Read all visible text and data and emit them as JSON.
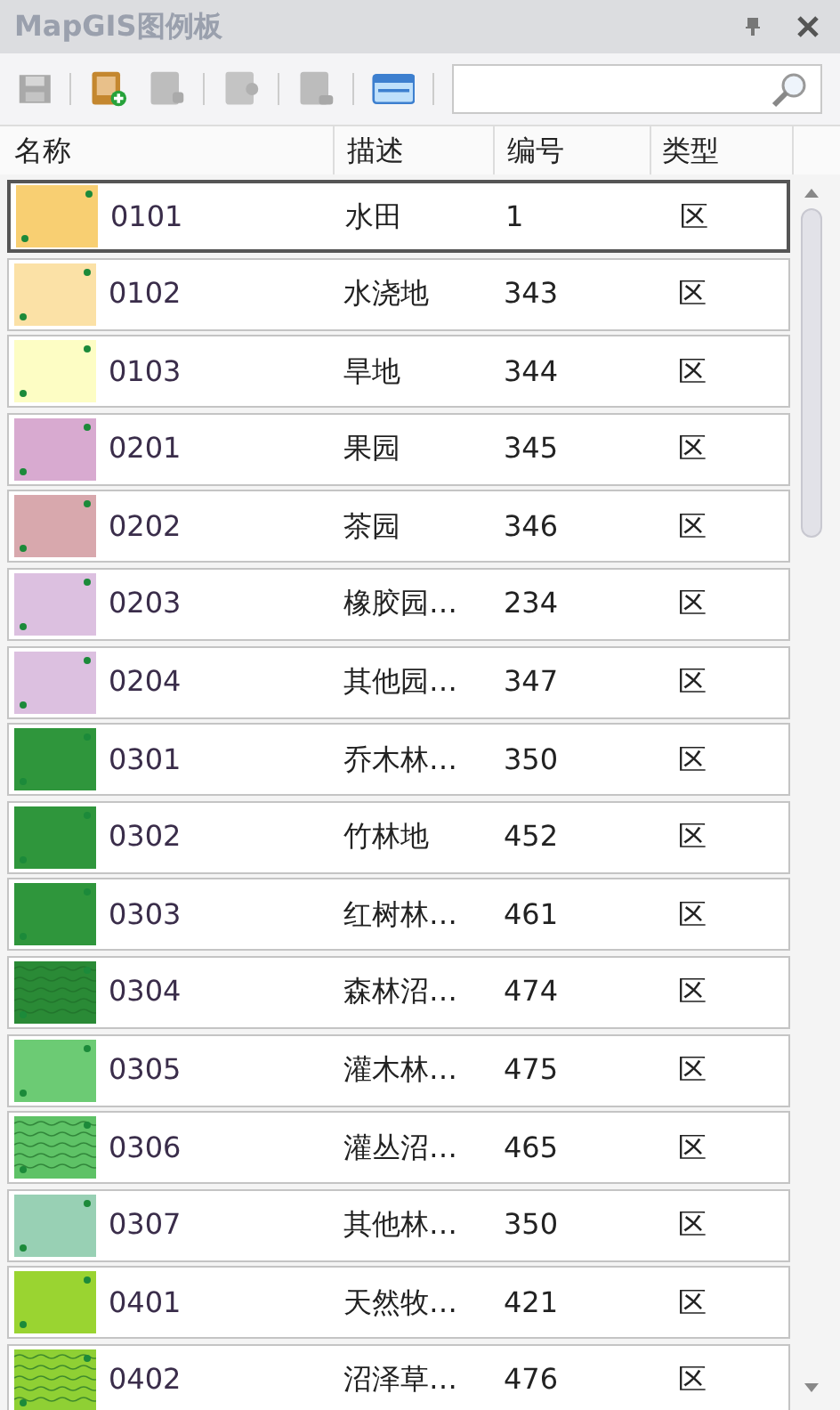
{
  "panel": {
    "title": "MapGIS图例板"
  },
  "table": {
    "columns": [
      "名称",
      "描述",
      "编号",
      "类型"
    ],
    "rows": [
      {
        "name": "0101",
        "description": "水田",
        "number": "1",
        "type": "区",
        "color": "#f8cf72",
        "textured": false,
        "selected": true
      },
      {
        "name": "0102",
        "description": "水浇地",
        "number": "343",
        "type": "区",
        "color": "#fbe1a6",
        "textured": false,
        "selected": false
      },
      {
        "name": "0103",
        "description": "旱地",
        "number": "344",
        "type": "区",
        "color": "#fdfdc4",
        "textured": false,
        "selected": false
      },
      {
        "name": "0201",
        "description": "果园",
        "number": "345",
        "type": "区",
        "color": "#d8aad0",
        "textured": false,
        "selected": false
      },
      {
        "name": "0202",
        "description": "茶园",
        "number": "346",
        "type": "区",
        "color": "#d8a8ad",
        "textured": false,
        "selected": false
      },
      {
        "name": "0203",
        "description": "橡胶园…",
        "number": "234",
        "type": "区",
        "color": "#dcc0e0",
        "textured": false,
        "selected": false
      },
      {
        "name": "0204",
        "description": "其他园…",
        "number": "347",
        "type": "区",
        "color": "#dcc0e0",
        "textured": false,
        "selected": false
      },
      {
        "name": "0301",
        "description": "乔木林…",
        "number": "350",
        "type": "区",
        "color": "#2f963c",
        "textured": false,
        "selected": false
      },
      {
        "name": "0302",
        "description": "竹林地",
        "number": "452",
        "type": "区",
        "color": "#2f963c",
        "textured": false,
        "selected": false
      },
      {
        "name": "0303",
        "description": "红树林…",
        "number": "461",
        "type": "区",
        "color": "#2f963c",
        "textured": false,
        "selected": false
      },
      {
        "name": "0304",
        "description": "森林沼…",
        "number": "474",
        "type": "区",
        "color": "#2a8a36",
        "textured": true,
        "selected": false
      },
      {
        "name": "0305",
        "description": "灌木林…",
        "number": "475",
        "type": "区",
        "color": "#6ccb74",
        "textured": false,
        "selected": false
      },
      {
        "name": "0306",
        "description": "灌丛沼…",
        "number": "465",
        "type": "区",
        "color": "#5ec266",
        "textured": true,
        "selected": false
      },
      {
        "name": "0307",
        "description": "其他林…",
        "number": "350",
        "type": "区",
        "color": "#98d0b4",
        "textured": false,
        "selected": false
      },
      {
        "name": "0401",
        "description": "天然牧…",
        "number": "421",
        "type": "区",
        "color": "#9ad431",
        "textured": false,
        "selected": false
      },
      {
        "name": "0402",
        "description": "沼泽草…",
        "number": "476",
        "type": "区",
        "color": "#8fd034",
        "textured": true,
        "selected": false
      }
    ]
  }
}
